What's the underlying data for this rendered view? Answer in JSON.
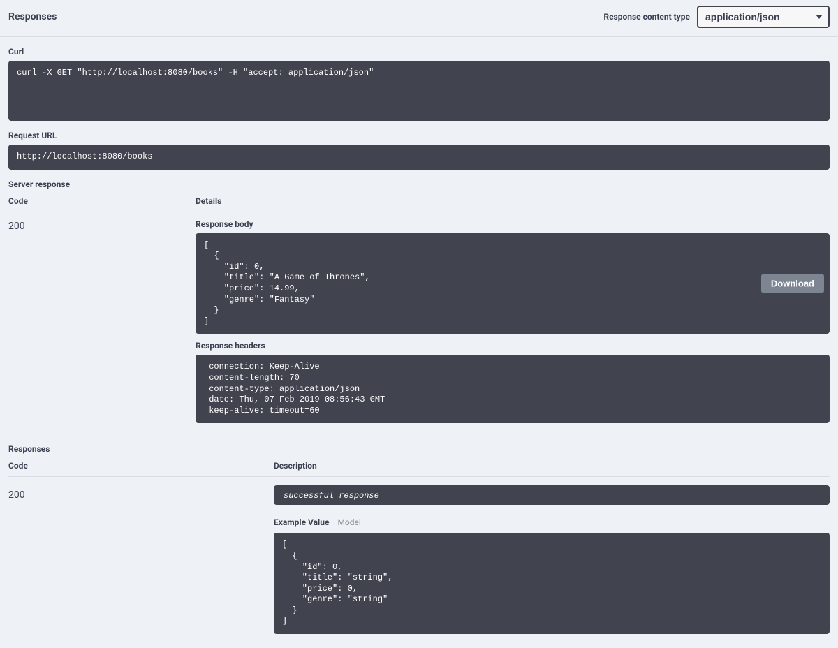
{
  "header": {
    "title": "Responses",
    "content_type_label": "Response content type",
    "content_type_value": "application/json"
  },
  "curl": {
    "label": "Curl",
    "command": "curl -X GET \"http://localhost:8080/books\" -H \"accept: application/json\""
  },
  "request_url": {
    "label": "Request URL",
    "value": "http://localhost:8080/books"
  },
  "server_response": {
    "label": "Server response",
    "headers": {
      "code": "Code",
      "details": "Details"
    },
    "code": "200",
    "response_body_label": "Response body",
    "response_body": "[\n  {\n    \"id\": 0,\n    \"title\": \"A Game of Thrones\",\n    \"price\": 14.99,\n    \"genre\": \"Fantasy\"\n  }\n]",
    "download_label": "Download",
    "response_headers_label": "Response headers",
    "response_headers": " connection: Keep-Alive\n content-length: 70\n content-type: application/json\n date: Thu, 07 Feb 2019 08:56:43 GMT\n keep-alive: timeout=60"
  },
  "responses_section": {
    "label": "Responses",
    "headers": {
      "code": "Code",
      "description": "Description"
    },
    "code": "200",
    "description": "successful response",
    "tabs": {
      "example": "Example Value",
      "model": "Model"
    },
    "example_value": "[\n  {\n    \"id\": 0,\n    \"title\": \"string\",\n    \"price\": 0,\n    \"genre\": \"string\"\n  }\n]"
  }
}
